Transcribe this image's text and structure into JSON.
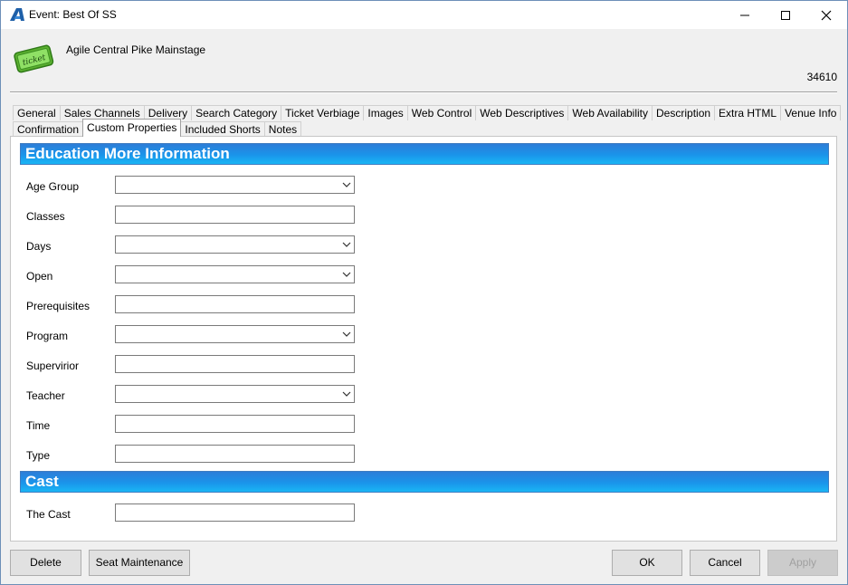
{
  "window": {
    "title": "Event: Best Of SS",
    "controls": [
      "minimize-icon",
      "maximize-icon",
      "close-icon"
    ]
  },
  "header": {
    "icon": "ticket-icon",
    "icon_text": "ticket",
    "venue": "Agile Central Pike Mainstage",
    "event_id": "34610"
  },
  "tabs": {
    "row1": [
      "General",
      "Sales Channels",
      "Delivery",
      "Search Category",
      "Ticket Verbiage",
      "Images",
      "Web Control",
      "Web Descriptives",
      "Web Availability",
      "Description",
      "Extra HTML",
      "Venue Info"
    ],
    "row2": [
      "Confirmation",
      "Custom Properties",
      "Included Shorts",
      "Notes"
    ],
    "active": "Custom Properties"
  },
  "sections": [
    {
      "title": "Education More Information",
      "fields": [
        {
          "label": "Age Group",
          "type": "dropdown",
          "value": ""
        },
        {
          "label": "Classes",
          "type": "text",
          "value": ""
        },
        {
          "label": "Days",
          "type": "dropdown",
          "value": ""
        },
        {
          "label": "Open",
          "type": "dropdown",
          "value": ""
        },
        {
          "label": "Prerequisites",
          "type": "text",
          "value": ""
        },
        {
          "label": "Program",
          "type": "dropdown",
          "value": ""
        },
        {
          "label": "Supervirior",
          "type": "text",
          "value": ""
        },
        {
          "label": "Teacher",
          "type": "dropdown",
          "value": ""
        },
        {
          "label": "Time",
          "type": "text",
          "value": ""
        },
        {
          "label": "Type",
          "type": "text",
          "value": ""
        }
      ]
    },
    {
      "title": "Cast",
      "fields": [
        {
          "label": "The Cast",
          "type": "text",
          "value": ""
        }
      ]
    }
  ],
  "buttons": {
    "delete": "Delete",
    "seat_maintenance": "Seat Maintenance",
    "ok": "OK",
    "cancel": "Cancel",
    "apply": "Apply"
  },
  "colors": {
    "section_header": "#1a94ea",
    "window_border": "#6d8fb8",
    "ticket_green": "#7ed957"
  }
}
